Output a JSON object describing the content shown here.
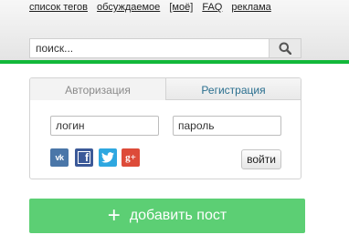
{
  "topnav": {
    "items": [
      "список тегов",
      "обсуждаемое",
      "[моё]",
      "FAQ",
      "реклама"
    ]
  },
  "search": {
    "placeholder": "поиск...",
    "icon": "search-icon"
  },
  "auth": {
    "tabs": [
      "Авторизация",
      "Регистрация"
    ],
    "active_tab": "Авторизация",
    "login_placeholder": "логин",
    "password_placeholder": "пароль",
    "social": {
      "vk": "vk",
      "fb": "f",
      "gp": "g+"
    },
    "submit_label": "войти"
  },
  "add_post": {
    "icon": "+",
    "label": "добавить пост"
  },
  "colors": {
    "accent_green": "#12b83a",
    "button_green": "#5ccf74",
    "register_tab_text": "#2a6f8f"
  }
}
